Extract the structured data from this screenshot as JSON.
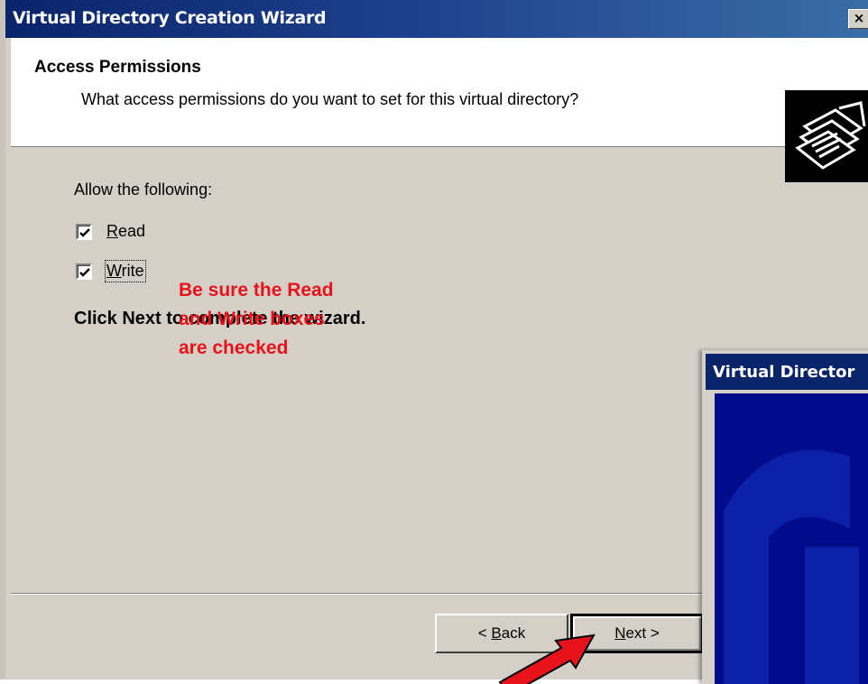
{
  "window": {
    "title": "Virtual Directory Creation Wizard",
    "close_label": "×"
  },
  "header": {
    "title": "Access Permissions",
    "subtitle": "What access permissions do you want to set for this virtual directory?"
  },
  "body": {
    "allow_label": "Allow the following:",
    "permissions": [
      {
        "accel": "R",
        "rest": "ead",
        "checked": true
      },
      {
        "accel": "W",
        "rest": "rite",
        "checked": true
      }
    ],
    "click_next_text": "Click Next to complete the wizard."
  },
  "annotation": {
    "lines": [
      "Be sure the Read",
      "and Write boxes",
      "are checked"
    ],
    "color": "#e8121a"
  },
  "buttons": {
    "back": {
      "prefix": "< ",
      "accel": "B",
      "rest": "ack"
    },
    "next": {
      "accel": "N",
      "rest": "ext",
      "suffix": " >"
    }
  },
  "overlay_window": {
    "title": "Virtual Director"
  },
  "colors": {
    "titlebar": "#0a246a",
    "dialog_face": "#d4d0c8",
    "arrow": "#e8121a"
  }
}
